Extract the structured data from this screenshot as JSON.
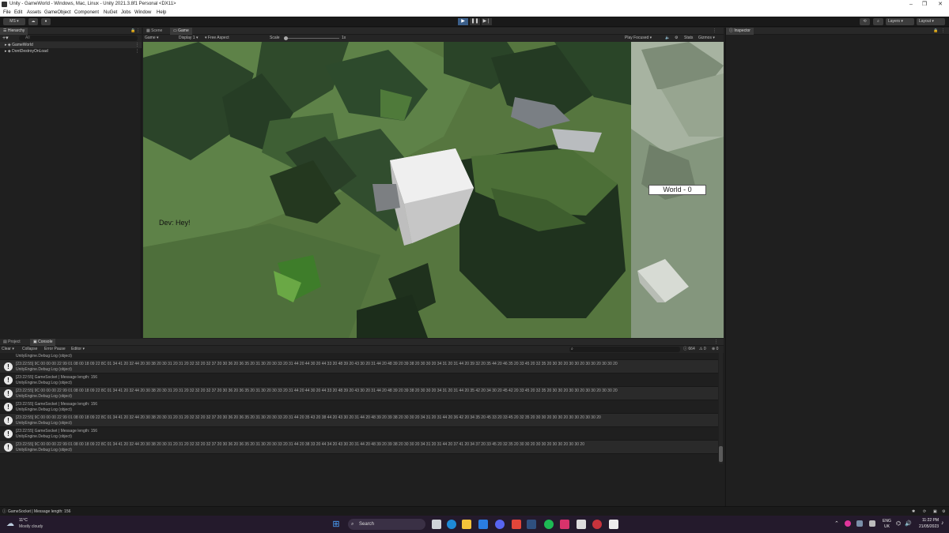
{
  "window": {
    "title": "Unity - GameWorld - Windows, Mac, Linux - Unity 2021.3.8f1 Personal <DX11>",
    "controls": [
      "–",
      "❐",
      "✕"
    ]
  },
  "menu": [
    "File",
    "Edit",
    "Assets",
    "GameObject",
    "Component",
    "NuGet",
    "Jobs",
    "Window",
    "Help"
  ],
  "toolbar": {
    "account": "MS ▾",
    "layers": "Layers",
    "layout": "Layout"
  },
  "hierarchy": {
    "tab": "Hierarchy",
    "search_placeholder": "All",
    "items": [
      {
        "label": "GameWorld"
      },
      {
        "label": "DontDestroyOnLoad"
      }
    ]
  },
  "scene_tabs": {
    "scene": "Scene",
    "game": "Game"
  },
  "game_toolbar": {
    "mode": "Game",
    "display": "Display 1",
    "aspect": "Free Aspect",
    "scale_label": "Scale",
    "scale_value": "1x",
    "play_focused": "Play Focused",
    "stats": "Stats",
    "gizmos": "Gizmos"
  },
  "game_view": {
    "chat_text": "Dev: Hey!",
    "world_label": "World - 0"
  },
  "inspector": {
    "tab": "Inspector"
  },
  "console": {
    "tabs": {
      "project": "Project",
      "console": "Console"
    },
    "buttons": {
      "clear": "Clear",
      "collapse": "Collapse",
      "error_pause": "Error Pause",
      "editor": "Editor"
    },
    "counts": {
      "info": "664",
      "warn": "0",
      "error": "0"
    },
    "entries": [
      {
        "line1": "",
        "line2": "UnityEngine.Debug:Log (object)"
      },
      {
        "line1": "[23:22:55] 9C 00 00 00 22 99 01 08 00 18 09 22 8C 01 34 41 20 32 44 20 30 38 20 30 31 20 31 20 32 32 20 32 37 20 30 36 20 36 35 20 31 30 20 30 33 20 31 44 20 44 30 20 44 33 20 48 39 20 43 30 20 31 44 20 48 39 20 39 38 20 30 30 20 34 31 20 31 44 20 39 32 20 35 44 20 46 35 20 33 45 20 32 35 20 30 30 20 30 30 20 30 30 20 30 30 20",
        "line2": "UnityEngine.Debug:Log (object)"
      },
      {
        "line1": "[23:22:55] GameSocket | Message length: 156",
        "line2": "UnityEngine.Debug:Log (object)"
      },
      {
        "line1": "[23:22:55] 9C 00 00 00 22 99 01 08 00 18 09 22 8C 01 34 41 20 32 44 20 30 38 20 30 31 20 31 20 32 32 20 32 37 20 30 36 20 36 35 20 31 30 20 30 33 20 31 44 20 44 30 20 44 33 20 48 39 20 43 30 20 31 44 20 48 39 20 39 38 20 30 30 20 34 31 20 31 44 20 35 42 20 34 30 20 45 42 20 33 45 20 32 35 20 30 30 20 30 30 20 30 30 20 30 30 20",
        "line2": "UnityEngine.Debug:Log (object)"
      },
      {
        "line1": "[23:22:55] GameSocket | Message length: 156",
        "line2": "UnityEngine.Debug:Log (object)"
      },
      {
        "line1": "[23:22:55] 9C 00 00 00 22 99 01 08 00 18 09 22 8C 01 34 41 20 32 44 20 30 38 20 30 31 20 31 20 32 32 20 32 37 20 30 36 20 36 35 20 31 30 20 30 33 20 31 44 20 35 43 20 38 44 20 43 30 20 31 44 20 48 39 20 39 38 20 30 30 20 34 31 20 31 44 20 36 42 20 34 35 20 45 33 20 33 45 20 32 35 20 30 30 20 30 30 20 30 30 20 30 30 20",
        "line2": "UnityEngine.Debug:Log (object)"
      },
      {
        "line1": "[23:22:55] GameSocket | Message length: 156",
        "line2": "UnityEngine.Debug:Log (object)"
      },
      {
        "line1": "[23:22:55] 9C 00 00 00 22 99 01 08 00 18 09 22 8C 01 34 41 20 32 44 20 30 38 20 30 31 20 31 20 32 32 20 32 37 20 30 36 20 36 35 20 31 30 20 30 33 20 31 44 20 38 33 20 44 34 20 43 30 20 31 44 20 48 39 20 39 38 20 30 30 20 34 31 20 31 44 20 37 41 20 34 37 20 33 45 20 32 35 20 30 30 20 30 30 20 30 30 20 30 30 20",
        "line2": "UnityEngine.Debug:Log (object)"
      }
    ]
  },
  "statusbar": {
    "message": "GameSocket | Message length: 156"
  },
  "taskbar": {
    "weather_temp": "11°C",
    "weather_desc": "Mostly cloudy",
    "search": "Search",
    "lang1": "ENG",
    "lang2": "UK",
    "time": "11:22 PM",
    "date": "21/05/2023"
  }
}
